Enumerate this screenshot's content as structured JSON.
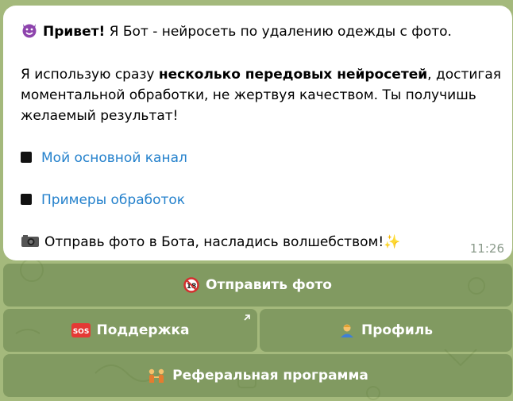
{
  "message": {
    "greeting_bold": "Привет!",
    "greeting_rest": " Я Бот - нейросеть по удалению одежды с фото.",
    "p2_start": "Я использую сразу ",
    "p2_bold": "несколько передовых нейросетей",
    "p2_end": ", достигая",
    "p2_line2": "моментальной обработки, не жертвуя качеством. Ты получишь",
    "p2_line3": "желаемый результат!",
    "link1": "Мой основной канал",
    "link2": "Примеры обработок",
    "closing": "Отправь фото в Бота, насладись волшебством!",
    "sparkle": "✨",
    "time": "11:26"
  },
  "buttons": {
    "send_photo": "Отправить фото",
    "support": "Поддержка",
    "support_icon_text": "SOS",
    "profile": "Профиль",
    "referral": "Реферальная программа"
  },
  "colors": {
    "link": "#2481cc",
    "bubble": "#ffffff",
    "wallpaper": "#a4b97c",
    "button_bg": "rgba(74,104,52,0.38)"
  },
  "icons": [
    "smiling-devil-icon",
    "black-square-icon",
    "camera-icon",
    "sparkles-icon",
    "no-under-18-icon",
    "sos-icon",
    "person-icon",
    "people-holding-hands-icon",
    "external-link-arrow-icon"
  ]
}
